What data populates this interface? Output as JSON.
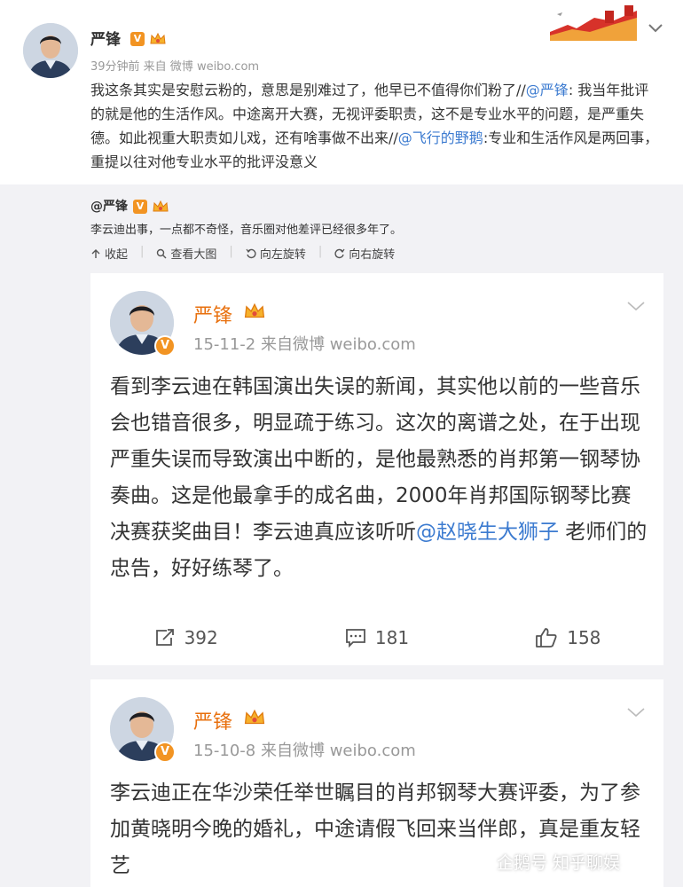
{
  "top_post": {
    "author": "严锋",
    "verified_badge": "V",
    "meta": "39分钟前 来自 微博 weibo.com",
    "text_prefix": "我这条其实是安慰云粉的，意思是别难过了，他早已不值得你们粉了//",
    "mention_1": "@严锋",
    "text_middle": ": 我当年批评的就是他的生活作风。中途离开大赛，无视评委职责，这不是专业水平的问题，是严重失德。如此视重大职责如儿戏，还有啥事做不出来//",
    "mention_2": "@飞行的野鹅",
    "text_suffix": ":专业和生活作风是两回事，重提以往对他专业水平的批评没意义"
  },
  "repost": {
    "author": "@严锋",
    "verified_badge": "V",
    "text": "李云迪出事，一点都不奇怪，音乐圈对他差评已经很多年了。",
    "actions": [
      "收起",
      "查看大图",
      "向左旋转",
      "向右旋转"
    ]
  },
  "card1": {
    "author": "严锋",
    "verified_badge": "V",
    "meta": "15-11-2  来自微博 weibo.com",
    "text_prefix": "看到李云迪在韩国演出失误的新闻，其实他以前的一些音乐会也错音很多，明显疏于练习。这次的离谱之处，在于出现严重失误而导致演出中断的，是他最熟悉的肖邦第一钢琴协奏曲。这是他最拿手的成名曲，2000年肖邦国际钢琴比赛决赛获奖曲目！李云迪真应该听听",
    "mention": "@赵晓生大狮子",
    "text_suffix": " 老师们的忠告，好好练琴了。",
    "reposts": "392",
    "comments": "181",
    "likes": "158"
  },
  "card2": {
    "author": "严锋",
    "verified_badge": "V",
    "meta": "15-10-8  来自微博 weibo.com",
    "text": "李云迪正在华沙荣任举世瞩目的肖邦钢琴大赛评委，为了参加黄晓明今晚的婚礼，中途请假飞回来当伴郎，真是重友轻艺"
  },
  "watermark": "企鹅号 知乎聊娱",
  "colors": {
    "link": "#3c7bd0",
    "name_orange": "#e8700e",
    "badge": "#f29423"
  }
}
